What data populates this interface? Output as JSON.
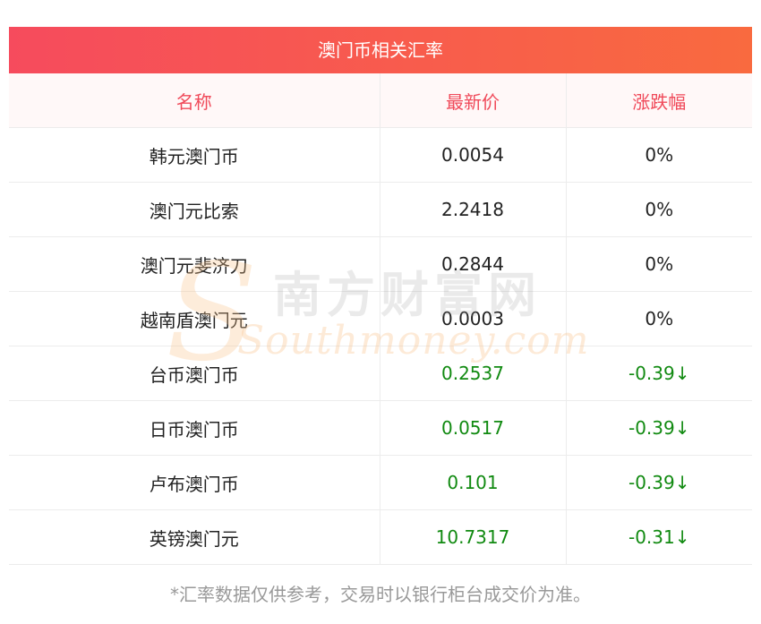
{
  "title": "澳门币相关汇率",
  "headers": {
    "name": "名称",
    "price": "最新价",
    "change": "涨跌幅"
  },
  "rows": [
    {
      "name": "韩元澳门币",
      "price": "0.0054",
      "change": "0%",
      "trend": "flat"
    },
    {
      "name": "澳门元比索",
      "price": "2.2418",
      "change": "0%",
      "trend": "flat"
    },
    {
      "name": "澳门元斐济刀",
      "price": "0.2844",
      "change": "0%",
      "trend": "flat"
    },
    {
      "name": "越南盾澳门元",
      "price": "0.0003",
      "change": "0%",
      "trend": "flat"
    },
    {
      "name": "台币澳门币",
      "price": "0.2537",
      "change": "-0.39↓",
      "trend": "down"
    },
    {
      "name": "日币澳门币",
      "price": "0.0517",
      "change": "-0.39↓",
      "trend": "down"
    },
    {
      "name": "卢布澳门币",
      "price": "0.101",
      "change": "-0.39↓",
      "trend": "down"
    },
    {
      "name": "英镑澳门元",
      "price": "10.7317",
      "change": "-0.31↓",
      "trend": "down"
    }
  ],
  "watermark": {
    "logo_cn": "南方财富网",
    "logo_en": "Southmoney.com"
  },
  "footnote": "*汇率数据仅供参考，交易时以银行柜台成交价为准。",
  "colors": {
    "header_gradient_start": "#f64b5d",
    "header_gradient_end": "#f96a3f",
    "header_text": "#f04a5a",
    "down": "#118a11",
    "flat": "#222222"
  }
}
